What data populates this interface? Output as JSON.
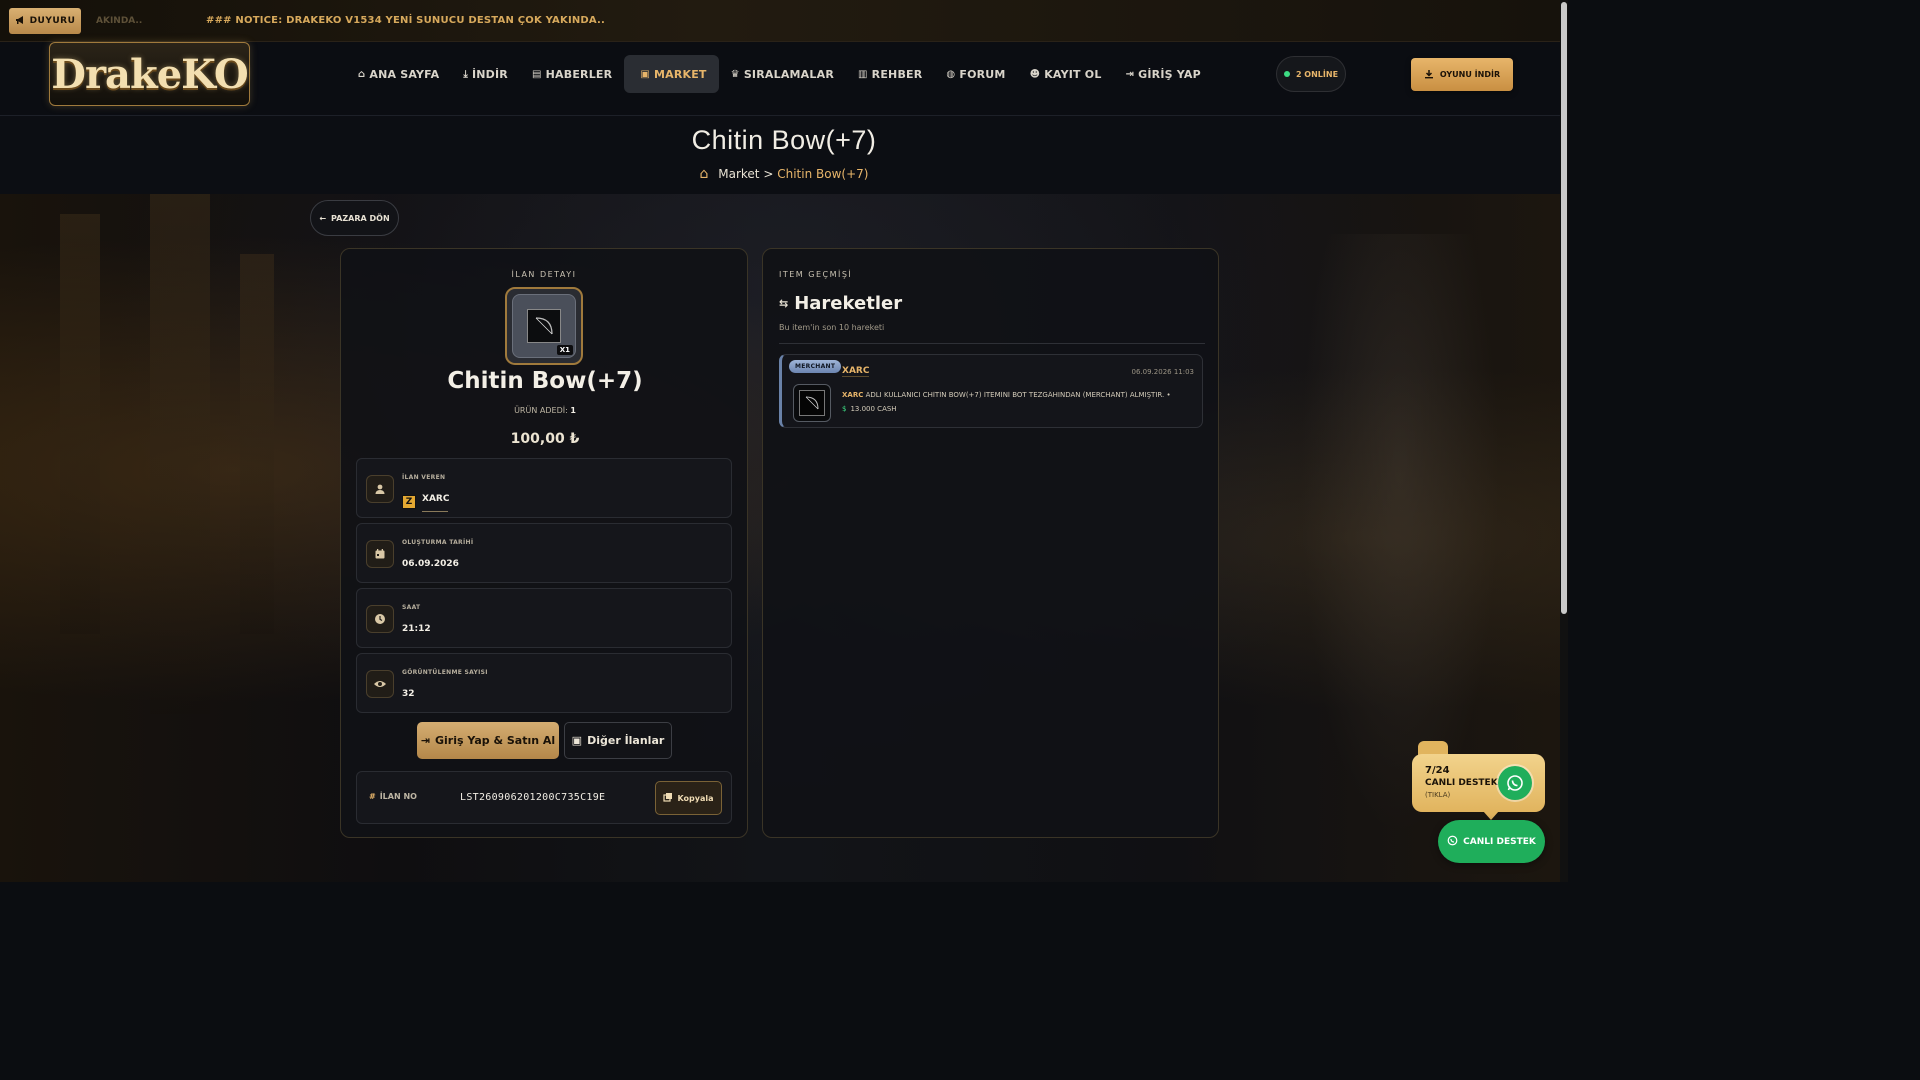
{
  "notice": {
    "badge_label": "DUYURU",
    "faded_text": "AKINDA..",
    "text": "### NOTICE: DRAKEKO V1534 YENİ SUNUCU DESTAN ÇOK YAKINDA.."
  },
  "header": {
    "logo_text": "DrakeKO",
    "nav": [
      {
        "label": "ANA SAYFA",
        "icon": "home-icon"
      },
      {
        "label": "İNDİR",
        "icon": "download-icon"
      },
      {
        "label": "HABERLER",
        "icon": "newspaper-icon"
      },
      {
        "label": "MARKET",
        "icon": "store-icon",
        "active": true
      },
      {
        "label": "SIRALAMALAR",
        "icon": "trophy-icon"
      },
      {
        "label": "REHBER",
        "icon": "book-icon"
      },
      {
        "label": "FORUM",
        "icon": "comments-icon"
      },
      {
        "label": "KAYIT OL",
        "icon": "user-plus-icon"
      },
      {
        "label": "GİRİŞ YAP",
        "icon": "sign-in-icon"
      }
    ],
    "online_label": "2 ONLİNE",
    "download_button": "OYUNU İNDİR",
    "online_dot_color": "#3ddc84",
    "accent_color": "#e7b56a"
  },
  "page": {
    "title": "Chitin Bow(+7)",
    "breadcrumb": {
      "parent": "Market",
      "separator": ">",
      "current": "Chitin Bow(+7)"
    }
  },
  "back_button": "PAZARA DÖN",
  "listing": {
    "section_label": "İLAN DETAYI",
    "item_name": "Chitin Bow(+7)",
    "item_qty_badge": "X1",
    "quantity_label": "ÜRÜN ADEDİ:",
    "quantity_value": "1",
    "price": "100,00 ₺",
    "seller_label": "İLAN VEREN",
    "seller_name": "XARC",
    "created_label": "OLUŞTURMA TARİHİ",
    "created_value": "06.09.2026",
    "time_label": "SAAT",
    "time_value": "21:12",
    "views_label": "GÖRÜNTÜLENME SAYISI",
    "views_value": "32",
    "buy_button": "Giriş Yap & Satın Al",
    "other_button": "Diğer İlanlar",
    "id_label": "İLAN NO",
    "id_value": "LST260906201200C735C19E",
    "copy_button": "Kopyala"
  },
  "history": {
    "section_label": "ITEM GEÇMİŞİ",
    "title": "Hareketler",
    "subtitle": "Bu item'in son 10 hareketi",
    "entries": [
      {
        "badge": "MERCHANT",
        "user": "XARC",
        "date": "06.09.2026 11:03",
        "desc_user": "XARC",
        "desc_text": "ADLI KULLANICI CHİTİN BOW(+7) İTEMİNİ BOT TEZGÂHINDAN (MERCHANT) ALMIŞTIR. •",
        "currency_symbol": "$",
        "amount": "13.000 CASH"
      }
    ]
  },
  "support": {
    "line1": "7/24",
    "line2": "CANLI DESTEK",
    "line3": "(TIKLA)",
    "button": "CANLI DESTEK",
    "color": "#1fae5b"
  }
}
